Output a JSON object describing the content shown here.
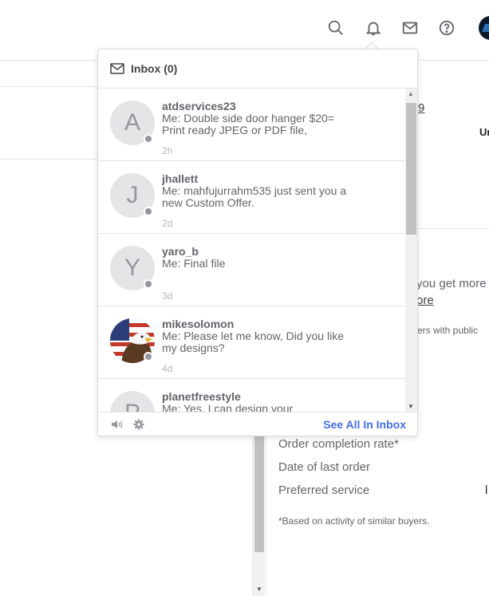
{
  "header": {
    "icons": [
      "search-icon",
      "bell-icon",
      "mail-icon",
      "help-icon"
    ]
  },
  "inbox": {
    "title": "Inbox (0)",
    "see_all_label": "See All In Inbox",
    "messages": [
      {
        "initial": "A",
        "name": "atdservices23",
        "preview": "Me: Double side door hanger $20= Print ready JPEG or PDF file,",
        "time": "2h"
      },
      {
        "initial": "J",
        "name": "jhallett",
        "preview": "Me: mahfujurrahm535 just sent you a new Custom Offer.",
        "time": "2d"
      },
      {
        "initial": "Y",
        "name": "yaro_b",
        "preview": "Me: Final file",
        "time": "3d"
      },
      {
        "initial": "",
        "name": "mikesolomon",
        "preview": "Me: Please let me know, Did you like my designs?",
        "time": "4d"
      },
      {
        "initial": "P",
        "name": "planetfreestyle",
        "preview": "Me: Yes, I can design your",
        "time": ""
      }
    ]
  },
  "background": {
    "fragment_9": "9",
    "fragment_un": "Un",
    "you_get_more": "you get more",
    "more_link": "ore",
    "buyers_public": "ers with public",
    "order_completion_rate": "Order completion rate*",
    "date_last_order": "Date of last order",
    "preferred_service": "Preferred service",
    "preferred_value": "l",
    "footnote": "*Based on activity of similar buyers."
  }
}
